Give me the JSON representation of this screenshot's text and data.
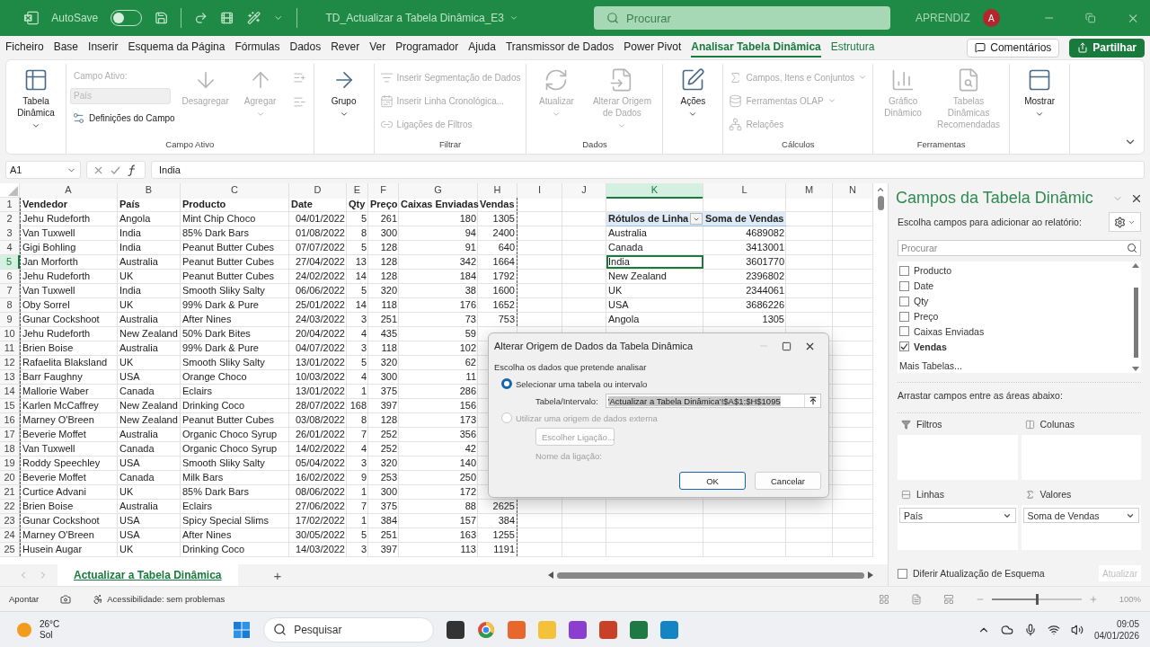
{
  "title_bar": {
    "autosave_label": "AutoSave",
    "autosave_on": false,
    "file_name": "TD_Actualizar a Tabela Dinâmica_E3",
    "search_placeholder": "Procurar",
    "user_name": "APRENDIZ",
    "avatar_initial": "A"
  },
  "menu": {
    "tabs": [
      {
        "label": "Ficheiro",
        "selected": false,
        "contextual": false
      },
      {
        "label": "Base",
        "selected": false,
        "contextual": false
      },
      {
        "label": "Inserir",
        "selected": false,
        "contextual": false
      },
      {
        "label": "Esquema da Página",
        "selected": false,
        "contextual": false
      },
      {
        "label": "Fórmulas",
        "selected": false,
        "contextual": false
      },
      {
        "label": "Dados",
        "selected": false,
        "contextual": false
      },
      {
        "label": "Rever",
        "selected": false,
        "contextual": false
      },
      {
        "label": "Ver",
        "selected": false,
        "contextual": false
      },
      {
        "label": "Programador",
        "selected": false,
        "contextual": false
      },
      {
        "label": "Ajuda",
        "selected": false,
        "contextual": false
      },
      {
        "label": "Transmissor de Dados",
        "selected": false,
        "contextual": false
      },
      {
        "label": "Power Pivot",
        "selected": false,
        "contextual": false
      },
      {
        "label": "Analisar Tabela Dinâmica",
        "selected": true,
        "contextual": true
      },
      {
        "label": "Estrutura",
        "selected": false,
        "contextual": true
      }
    ],
    "comments_button": "Comentários",
    "share_button": "Partilhar"
  },
  "ribbon": {
    "groups": [
      {
        "items": [
          {
            "kind": "large",
            "label": "Tabela Dinâmica",
            "dropdown": true,
            "disabled": false
          }
        ]
      },
      {
        "label": "Campo Ativo",
        "items": [
          {
            "kind": "stack",
            "children": [
              {
                "kind": "caption",
                "label": "Campo Ativo:",
                "disabled": true
              },
              {
                "kind": "field",
                "placeholder": "País",
                "disabled": true
              },
              {
                "kind": "small",
                "label": "Definições do Campo",
                "disabled": false
              }
            ]
          },
          {
            "kind": "large",
            "label": "Desagregar",
            "dropdown": false,
            "disabled": true
          },
          {
            "kind": "large",
            "label": "Agregar",
            "dropdown": true,
            "disabled": true
          },
          {
            "kind": "stack",
            "children": [
              {
                "kind": "icon",
                "disabled": true
              },
              {
                "kind": "icon",
                "disabled": true
              }
            ]
          }
        ]
      },
      {
        "items": [
          {
            "kind": "large",
            "label": "Grupo",
            "dropdown": true,
            "disabled": false
          }
        ]
      },
      {
        "label": "Filtrar",
        "items": [
          {
            "kind": "stack",
            "children": [
              {
                "kind": "small",
                "label": "Inserir Segmentação de Dados",
                "disabled": true
              },
              {
                "kind": "small",
                "label": "Inserir Linha Cronológica...",
                "disabled": true
              },
              {
                "kind": "small",
                "label": "Ligações de Filtros",
                "disabled": true
              }
            ]
          }
        ]
      },
      {
        "label": "Dados",
        "items": [
          {
            "kind": "large",
            "label": "Atualizar",
            "dropdown": true,
            "disabled": true
          },
          {
            "kind": "large",
            "label": "Alterar Origem de Dados",
            "dropdown": true,
            "disabled": true
          }
        ]
      },
      {
        "items": [
          {
            "kind": "large",
            "label": "Ações",
            "dropdown": true,
            "disabled": false
          }
        ]
      },
      {
        "label": "Cálculos",
        "items": [
          {
            "kind": "stack",
            "children": [
              {
                "kind": "small",
                "label": "Campos, Itens e Conjuntos",
                "dropdown": true,
                "disabled": true
              },
              {
                "kind": "small",
                "label": "Ferramentas OLAP",
                "dropdown": true,
                "disabled": true
              },
              {
                "kind": "small",
                "label": "Relações",
                "disabled": true
              }
            ]
          }
        ]
      },
      {
        "label": "Ferramentas",
        "items": [
          {
            "kind": "large",
            "label": "Gráfico Dinâmico",
            "dropdown": false,
            "disabled": true
          },
          {
            "kind": "large",
            "label": "Tabelas Dinâmicas Recomendadas",
            "dropdown": false,
            "disabled": true
          }
        ]
      },
      {
        "items": [
          {
            "kind": "large",
            "label": "Mostrar",
            "dropdown": true,
            "disabled": false
          }
        ]
      }
    ]
  },
  "formula_bar": {
    "name_box": "A1",
    "formula": "India"
  },
  "sheet": {
    "columns": [
      {
        "label": "A",
        "selected": false
      },
      {
        "label": "B",
        "selected": false
      },
      {
        "label": "C",
        "selected": false
      },
      {
        "label": "D",
        "selected": false
      },
      {
        "label": "E",
        "selected": false
      },
      {
        "label": "F",
        "selected": false
      },
      {
        "label": "G",
        "selected": false
      },
      {
        "label": "H",
        "selected": false
      },
      {
        "label": "I",
        "selected": false
      },
      {
        "label": "J",
        "selected": false
      },
      {
        "label": "K",
        "selected": true
      },
      {
        "label": "L",
        "selected": false
      },
      {
        "label": "M",
        "selected": false
      },
      {
        "label": "N",
        "selected": false
      }
    ],
    "rows": [
      {
        "number": "1",
        "selected": false,
        "cells": [
          "Vendedor",
          "País",
          "Producto",
          "Date",
          "Qty",
          "Preço",
          "Caixas Enviadas",
          "Vendas"
        ]
      },
      {
        "number": "2",
        "selected": false,
        "cells": [
          "Jehu Rudeforth",
          "Angola",
          "Mint Chip Choco",
          "04/01/2022",
          "5",
          "261",
          "180",
          "1305"
        ]
      },
      {
        "number": "3",
        "selected": false,
        "cells": [
          "Van Tuxwell",
          "India",
          "85% Dark Bars",
          "01/08/2022",
          "8",
          "300",
          "94",
          "2400"
        ]
      },
      {
        "number": "4",
        "selected": false,
        "cells": [
          "Gigi Bohling",
          "India",
          "Peanut Butter Cubes",
          "07/07/2022",
          "5",
          "128",
          "91",
          "640"
        ]
      },
      {
        "number": "5",
        "selected": true,
        "cells": [
          "Jan Morforth",
          "Australia",
          "Peanut Butter Cubes",
          "27/04/2022",
          "13",
          "128",
          "342",
          "1664"
        ]
      },
      {
        "number": "6",
        "selected": false,
        "cells": [
          "Jehu Rudeforth",
          "UK",
          "Peanut Butter Cubes",
          "24/02/2022",
          "14",
          "128",
          "184",
          "1792"
        ]
      },
      {
        "number": "7",
        "selected": false,
        "cells": [
          "Van Tuxwell",
          "India",
          "Smooth Sliky Salty",
          "06/06/2022",
          "5",
          "320",
          "38",
          "1600"
        ]
      },
      {
        "number": "8",
        "selected": false,
        "cells": [
          "Oby Sorrel",
          "UK",
          "99% Dark & Pure",
          "25/01/2022",
          "14",
          "118",
          "176",
          "1652"
        ]
      },
      {
        "number": "9",
        "selected": false,
        "cells": [
          "Gunar Cockshoot",
          "Australia",
          "After Nines",
          "24/03/2022",
          "3",
          "251",
          "73",
          "753"
        ]
      },
      {
        "number": "10",
        "selected": false,
        "cells": [
          "Jehu Rudeforth",
          "New Zealand",
          "50% Dark Bites",
          "20/04/2022",
          "4",
          "435",
          "59"
        ]
      },
      {
        "number": "11",
        "selected": false,
        "cells": [
          "Brien Boise",
          "Australia",
          "99% Dark & Pure",
          "04/07/2022",
          "3",
          "118",
          "102"
        ]
      },
      {
        "number": "12",
        "selected": false,
        "cells": [
          "Rafaelita Blaksland",
          "UK",
          "Smooth Sliky Salty",
          "13/01/2022",
          "5",
          "320",
          "62"
        ]
      },
      {
        "number": "13",
        "selected": false,
        "cells": [
          "Barr Faughny",
          "USA",
          "Orange Choco",
          "10/03/2022",
          "4",
          "300",
          "11"
        ]
      },
      {
        "number": "14",
        "selected": false,
        "cells": [
          "Mallorie Waber",
          "Canada",
          "Eclairs",
          "13/01/2022",
          "1",
          "375",
          "286"
        ]
      },
      {
        "number": "15",
        "selected": false,
        "cells": [
          "Karlen McCaffrey",
          "New Zealand",
          "Drinking Coco",
          "28/07/2022",
          "168",
          "397",
          "156"
        ]
      },
      {
        "number": "16",
        "selected": false,
        "cells": [
          "Marney O'Breen",
          "New Zealand",
          "Peanut Butter Cubes",
          "03/08/2022",
          "8",
          "128",
          "173"
        ]
      },
      {
        "number": "17",
        "selected": false,
        "cells": [
          "Beverie Moffet",
          "Australia",
          "Organic Choco Syrup",
          "26/01/2022",
          "7",
          "252",
          "356"
        ]
      },
      {
        "number": "18",
        "selected": false,
        "cells": [
          "Van Tuxwell",
          "Canada",
          "Organic Choco Syrup",
          "14/02/2022",
          "4",
          "252",
          "42"
        ]
      },
      {
        "number": "19",
        "selected": false,
        "cells": [
          "Roddy Speechley",
          "USA",
          "Smooth Sliky Salty",
          "05/04/2022",
          "3",
          "320",
          "140"
        ]
      },
      {
        "number": "20",
        "selected": false,
        "cells": [
          "Beverie Moffet",
          "Canada",
          "Milk Bars",
          "16/02/2022",
          "9",
          "253",
          "250"
        ]
      },
      {
        "number": "21",
        "selected": false,
        "cells": [
          "Curtice Advani",
          "UK",
          "85% Dark Bars",
          "08/06/2022",
          "1",
          "300",
          "172"
        ]
      },
      {
        "number": "22",
        "selected": false,
        "cells": [
          "Brien Boise",
          "Australia",
          "Eclairs",
          "27/06/2022",
          "7",
          "375",
          "88",
          "2625"
        ]
      },
      {
        "number": "23",
        "selected": false,
        "cells": [
          "Gunar Cockshoot",
          "USA",
          "Spicy Special Slims",
          "17/02/2022",
          "1",
          "384",
          "157",
          "384"
        ]
      },
      {
        "number": "24",
        "selected": false,
        "cells": [
          "Marney O'Breen",
          "USA",
          "After Nines",
          "30/05/2022",
          "5",
          "251",
          "163",
          "1255"
        ]
      },
      {
        "number": "25",
        "selected": false,
        "cells": [
          "Husein Augar",
          "UK",
          "Drinking Coco",
          "14/03/2022",
          "3",
          "397",
          "113",
          "1191"
        ]
      }
    ],
    "pivot": {
      "header": [
        "Rótulos de Linha",
        "Soma de Vendas"
      ],
      "items": [
        {
          "label": "Australia",
          "value": "4689082",
          "selected": false
        },
        {
          "label": "Canada",
          "value": "3413001",
          "selected": false
        },
        {
          "label": "India",
          "value": "3601770",
          "selected": true
        },
        {
          "label": "New Zealand",
          "value": "2396802",
          "selected": false
        },
        {
          "label": "UK",
          "value": "2344061",
          "selected": false
        },
        {
          "label": "USA",
          "value": "3686226",
          "selected": false
        },
        {
          "label": "Angola",
          "value": "1305",
          "selected": false
        }
      ]
    },
    "tabs": [
      {
        "label": "Actualizar a Tabela Dinâmica",
        "selected": true
      }
    ],
    "add_sheet": "+"
  },
  "dialog": {
    "title": "Alterar Origem de Dados da Tabela Dinâmica",
    "prompt": "Escolha os dados que pretende analisar",
    "options": [
      {
        "label": "Selecionar uma tabela ou intervalo",
        "selected": true,
        "disabled": false
      },
      {
        "label": "Utilizar uma origem de dados externa",
        "selected": false,
        "disabled": true
      }
    ],
    "range_label": "Tabela/Intervalo:",
    "range_value": "'Actualizar a Tabela Dinâmica'!$A$1:$H$1095",
    "connection_button": "Escolher Ligação...",
    "connection_label": "Nome da ligação:",
    "ok_button": "OK",
    "cancel_button": "Cancelar"
  },
  "pane": {
    "title": "Campos da Tabela Dinâmic",
    "prompt": "Escolha campos para adicionar ao relatório:",
    "search_placeholder": "Procurar",
    "fields": [
      {
        "label": "Producto",
        "checked": false
      },
      {
        "label": "Date",
        "checked": false
      },
      {
        "label": "Qty",
        "checked": false
      },
      {
        "label": "Preço",
        "checked": false
      },
      {
        "label": "Caixas Enviadas",
        "checked": false
      },
      {
        "label": "Vendas",
        "checked": true
      }
    ],
    "more_tables": "Mais Tabelas...",
    "areas_prompt": "Arrastar campos entre as áreas abaixo:",
    "areas": [
      {
        "kind": "filters",
        "label": "Filtros"
      },
      {
        "kind": "columns",
        "label": "Colunas"
      },
      {
        "kind": "rows",
        "label": "Linhas",
        "fields": [
          "País"
        ]
      },
      {
        "kind": "values",
        "label": "Valores",
        "fields": [
          "Soma de Vendas"
        ]
      }
    ],
    "defer_label": "Diferir Atualização de Esquema",
    "defer_checked": false,
    "update_button": "Atualizar",
    "update_disabled": true
  },
  "status_bar": {
    "mode": "Apontar",
    "accessibility": "Acessibilidade: sem problemas",
    "zoom": {
      "level": 0.5,
      "reading": "100%"
    }
  },
  "taskbar": {
    "temperature": "26°C",
    "weather": "Sol",
    "search_placeholder": "Pesquisar",
    "time": "09:05",
    "date": "04/01/2026"
  }
}
